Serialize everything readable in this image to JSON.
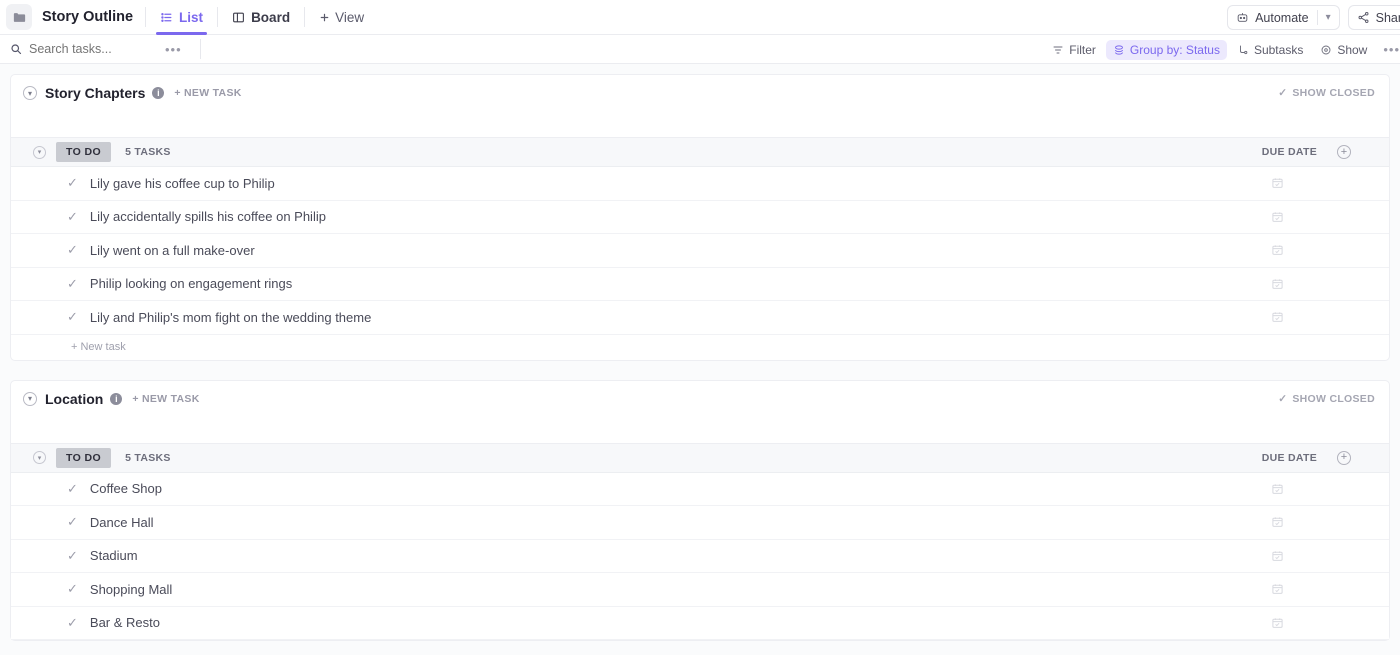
{
  "topbar": {
    "folder_icon": "folder-icon",
    "title": "Story Outline",
    "tabs": [
      {
        "label": "List",
        "icon": "list-icon",
        "active": true
      },
      {
        "label": "Board",
        "icon": "board-icon",
        "active": false
      }
    ],
    "add_view_label": "View",
    "automate_label": "Automate",
    "share_label": "Share"
  },
  "filterbar": {
    "search_placeholder": "Search tasks...",
    "overflow_label": "•••",
    "items": [
      {
        "label": "Filter",
        "icon": "filter-icon",
        "active": false
      },
      {
        "label": "Group by: Status",
        "icon": "group-icon",
        "active": true
      },
      {
        "label": "Subtasks",
        "icon": "subtasks-icon",
        "active": false
      },
      {
        "label": "Show",
        "icon": "eye-icon",
        "active": false
      }
    ],
    "more_label": "•••"
  },
  "common": {
    "new_task_link": "+ NEW TASK",
    "show_closed": "SHOW CLOSED",
    "info_char": "i",
    "due_date_header": "DUE DATE",
    "add_column": "+",
    "new_task_row": "+ New task",
    "status_label": "TO DO",
    "task_count": "5 TASKS"
  },
  "lists": [
    {
      "name": "Story Chapters",
      "group": {
        "status": "TO DO",
        "count": "5 TASKS"
      },
      "tasks": [
        {
          "name": "Lily gave his coffee cup to Philip"
        },
        {
          "name": "Lily accidentally spills his coffee on Philip"
        },
        {
          "name": "Lily went on a full make-over"
        },
        {
          "name": "Philip looking on engagement rings"
        },
        {
          "name": "Lily and Philip's mom fight on the wedding theme"
        }
      ]
    },
    {
      "name": "Location",
      "group": {
        "status": "TO DO",
        "count": "5 TASKS"
      },
      "tasks": [
        {
          "name": "Coffee Shop"
        },
        {
          "name": "Dance Hall"
        },
        {
          "name": "Stadium"
        },
        {
          "name": "Shopping Mall"
        },
        {
          "name": "Bar & Resto"
        }
      ]
    }
  ],
  "colors": {
    "accent": "#7b68ee",
    "accent_bg": "#ece9fd",
    "status_badge_bg": "#c9cbd1",
    "page_bg": "#fafbfc",
    "border": "#edeef2"
  }
}
